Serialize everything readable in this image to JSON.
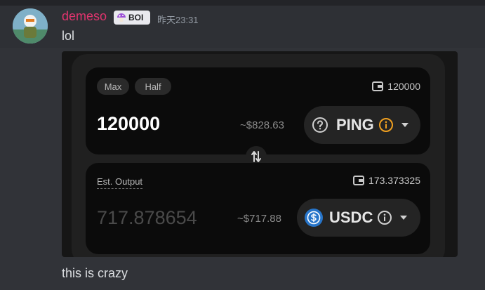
{
  "message": {
    "username": "demeso",
    "badge": "BOI",
    "timestamp": "昨天23:31",
    "text_before": "lol",
    "text_after": "this is crazy"
  },
  "embed": {
    "top": {
      "max_label": "Max",
      "half_label": "Half",
      "balance": "120000",
      "amount": "120000",
      "usd_value": "~$828.63",
      "token": "PING"
    },
    "bottom": {
      "est_label": "Est. Output",
      "balance": "173.373325",
      "amount": "717.878654",
      "usd_value": "~$717.88",
      "token": "USDC"
    }
  },
  "colors": {
    "username": "#e0346e",
    "warn_info": "#f0a020",
    "usdc_blue": "#2775ca"
  }
}
